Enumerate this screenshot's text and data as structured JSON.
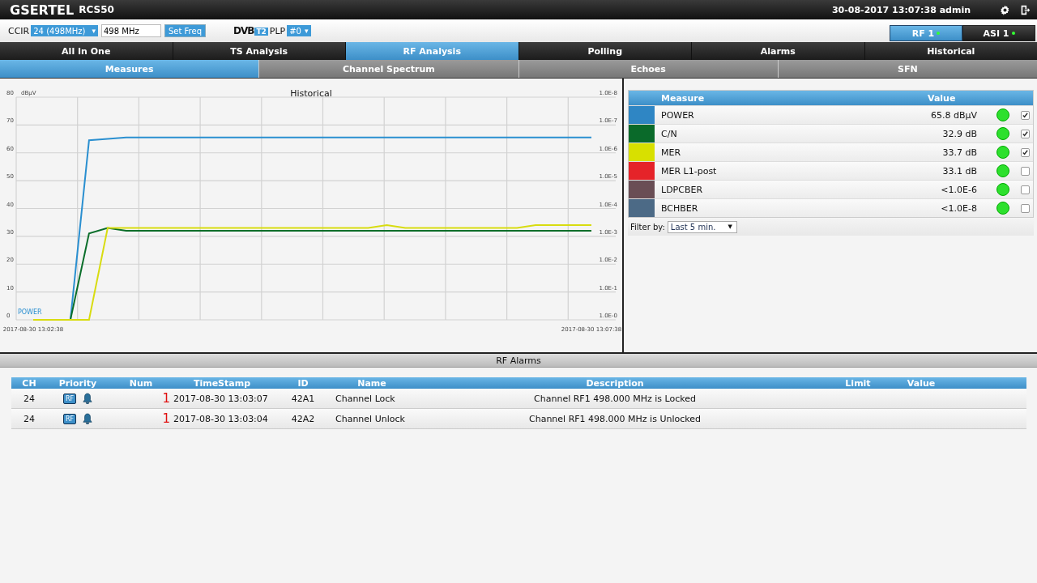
{
  "header": {
    "brand": "GSERTEL",
    "model": "RCS50",
    "datetime": "30-08-2017 13:07:38 admin"
  },
  "toolbar": {
    "ccir_label": "CCIR",
    "channel_select": "24 (498MHz)",
    "select_caret": "▾",
    "frequency": "498 MHz",
    "set_button": "Set Freq",
    "dvb_logo": {
      "text": "DVB",
      "badge": "T2"
    },
    "plp_label": "PLP",
    "plp_select": "#0",
    "plp_caret": "▾",
    "inputs": [
      {
        "label": "RF 1",
        "selected": true,
        "ok": true
      },
      {
        "label": "ASI 1",
        "selected": false,
        "ok": true
      }
    ]
  },
  "tabs": [
    {
      "label": "All In One",
      "selected": false
    },
    {
      "label": "TS Analysis",
      "selected": false
    },
    {
      "label": "RF Analysis",
      "selected": true
    },
    {
      "label": "Polling",
      "selected": false
    },
    {
      "label": "Alarms",
      "selected": false
    },
    {
      "label": "Historical",
      "selected": false
    }
  ],
  "subtabs": [
    {
      "label": "Measures",
      "selected": true
    },
    {
      "label": "Channel Spectrum",
      "selected": false
    },
    {
      "label": "Echoes",
      "selected": false
    },
    {
      "label": "SFN",
      "selected": false
    }
  ],
  "chart": {
    "unit": "dBµV",
    "right_axis_labels": [
      "1.0E-8",
      "1.0E-7",
      "1.0E-6",
      "1.0E-5",
      "1.0E-4",
      "1.0E-3",
      "1.0E-2",
      "1.0E-1",
      "1.0E-0"
    ],
    "chart_data": {
      "type": "line",
      "title": "Historical",
      "categories": [
        "2017-08-30 13:02:38",
        null,
        null,
        null,
        null,
        null,
        null,
        null,
        null,
        null,
        null,
        null,
        null,
        null,
        null,
        null,
        null,
        null,
        null,
        null,
        null,
        null,
        null,
        null,
        null,
        null,
        null,
        null,
        null,
        null,
        "2017-08-30 13:07:38"
      ],
      "ylim": [
        0,
        80
      ],
      "grid": true,
      "yticks": [
        0,
        10,
        20,
        30,
        40,
        50,
        60,
        70,
        80
      ],
      "series": [
        {
          "name": "POWER",
          "color": "#2a8fd0",
          "values": [
            0,
            0,
            0,
            64.5,
            65,
            65.5,
            65.5,
            65.5,
            65.5,
            65.5,
            65.5,
            65.5,
            65.5,
            65.5,
            65.5,
            65.5,
            65.5,
            65.5,
            65.5,
            65.5,
            65.5,
            65.5,
            65.5,
            65.5,
            65.5,
            65.5,
            65.5,
            65.5,
            65.5,
            65.5,
            65.5
          ]
        },
        {
          "color": "#0a6e2a",
          "values": [
            0,
            0,
            0,
            31,
            33,
            32,
            32,
            32,
            32,
            32,
            32,
            32,
            32,
            32,
            32,
            32,
            32,
            32,
            32,
            32,
            32,
            32,
            32,
            32,
            32,
            32,
            32,
            32,
            32,
            32,
            32
          ]
        },
        {
          "color": "#d8dc10",
          "values": [
            0,
            0,
            0,
            0,
            33,
            33,
            33,
            33,
            33,
            33,
            33,
            33,
            33,
            33,
            33,
            33,
            33,
            33,
            33,
            34,
            33,
            33,
            33,
            33,
            33,
            33,
            33,
            34,
            34,
            34,
            34
          ]
        }
      ]
    }
  },
  "measures": {
    "columns": [
      "Measure",
      "Value"
    ],
    "rows": [
      {
        "color": "#2f86c4",
        "name": "POWER",
        "value": "65.8 dBµV",
        "ok": true,
        "checked": true
      },
      {
        "color": "#0a6a2a",
        "name": "C/N",
        "value": "32.9 dB",
        "ok": true,
        "checked": true
      },
      {
        "color": "#d8e000",
        "name": "MER",
        "value": "33.7 dB",
        "ok": true,
        "checked": true
      },
      {
        "color": "#e52329",
        "name": "MER L1-post",
        "value": "33.1 dB",
        "ok": true,
        "checked": false
      },
      {
        "color": "#6a4e55",
        "name": "LDPCBER",
        "value": "<1.0E-6",
        "ok": true,
        "checked": false
      },
      {
        "color": "#4c6a86",
        "name": "BCHBER",
        "value": "<1.0E-8",
        "ok": true,
        "checked": false
      }
    ],
    "filter_label": "Filter by:",
    "filter_select": "Last 5 min.",
    "filter_caret": "▼"
  },
  "alarms": {
    "title": "RF Alarms",
    "columns": [
      "CH",
      "Priority",
      "Num",
      "TimeStamp",
      "ID",
      "Name",
      "Description",
      "Limit",
      "Value"
    ],
    "rows": [
      {
        "ch": "24",
        "badge": "RF",
        "num": "1",
        "timestamp": "2017-08-30 13:03:07",
        "id": "42A1",
        "name": "Channel Lock",
        "description": "Channel RF1 498.000 MHz is Locked"
      },
      {
        "ch": "24",
        "badge": "RF",
        "num": "1",
        "timestamp": "2017-08-30 13:03:04",
        "id": "42A2",
        "name": "Channel Unlock",
        "description": "Channel RF1 498.000 MHz is Unlocked"
      }
    ]
  }
}
